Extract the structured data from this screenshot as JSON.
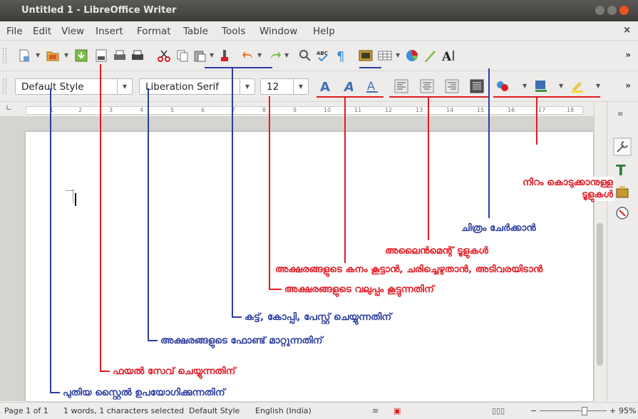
{
  "window": {
    "title": "Untitled 1 - LibreOffice Writer"
  },
  "menu": {
    "items": [
      "File",
      "Edit",
      "View",
      "Insert",
      "Format",
      "Table",
      "Tools",
      "Window",
      "Help"
    ],
    "close": "×"
  },
  "toolbar2": {
    "paragraph_style": "Default Style",
    "font_name": "Liberation Serif",
    "font_size": "12",
    "more": "»"
  },
  "toolbar1": {
    "more": "»"
  },
  "ruler": {
    "ticks": [
      "1",
      "2",
      "3",
      "4",
      "5",
      "6",
      "7",
      "8",
      "9",
      "10",
      "11",
      "12",
      "13",
      "14",
      "15",
      "16",
      "17",
      "18"
    ]
  },
  "annotations": {
    "color_tools": "നിറം കൊടുക്കാനുള്ള ടൂളുകൾ",
    "insert_image": "ചിത്രം ചേർക്കാൻ",
    "alignment_tools": "അലൈൻമെന്റ് ടൂളുകൾ",
    "bold_italic_underline": "അക്ഷരങ്ങളുടെ കനം കൂട്ടാൻ, ചരിച്ചെഴുതാൻ, അടിവരയിടാൻ",
    "font_size": "അക്ഷരങ്ങളുടെ വലുപ്പം കൂട്ടുന്നതിന്",
    "cut_copy_paste": "കട്ട്, കോപ്പി, പേസ്റ്റ് ചെയ്യുന്നതിന്",
    "change_font": "അക്ഷരങ്ങളുടെ ഫോണ്ട് മാറ്റുന്നതിന്",
    "save_file": "ഫയൽ സേവ് ചെയ്യുന്നതിന്",
    "new_style": "പുതിയ സ്റ്റൈൽ ഉപയോഗിക്കുന്നതിന്"
  },
  "status": {
    "page": "Page 1 of 1",
    "words": "1 words, 1 characters selected",
    "style": "Default Style",
    "language": "English (India)",
    "zoom": "95%",
    "zoom_minus": "−",
    "zoom_plus": "+"
  },
  "colors": {
    "red": "#e01b24",
    "blue": "#2c3e9e"
  }
}
